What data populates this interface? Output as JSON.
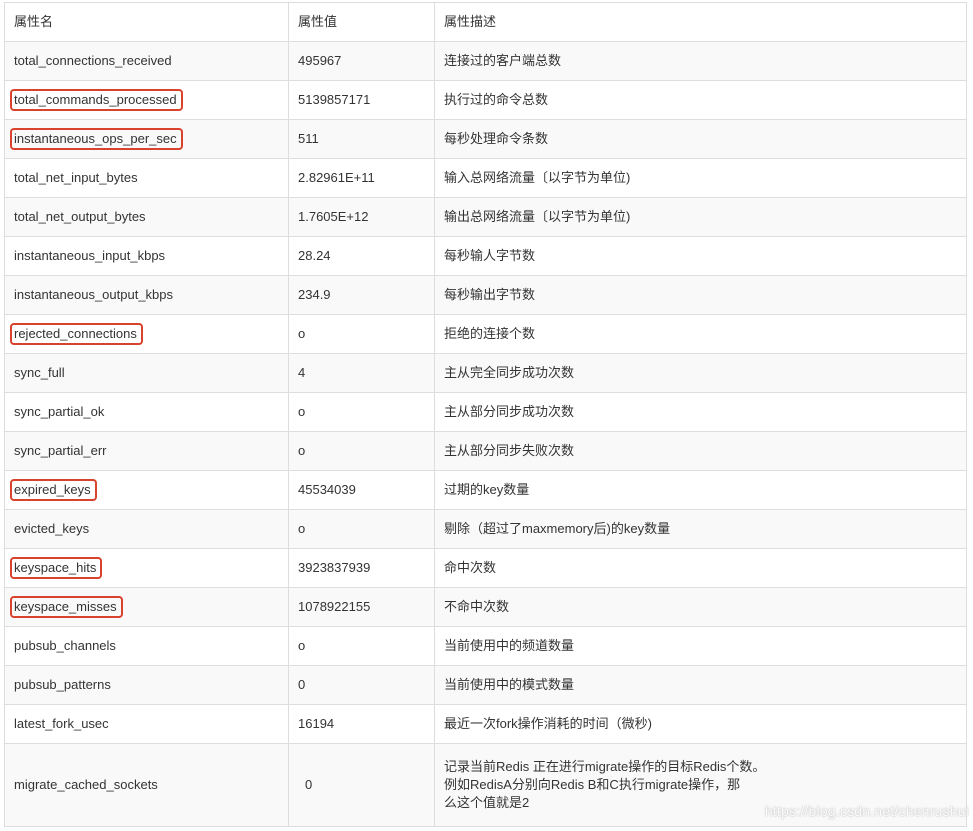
{
  "header": {
    "name": "属性名",
    "value": "属性值",
    "desc": "属性描述"
  },
  "rows": [
    {
      "name": "total_connections_received",
      "value": "495967",
      "desc": "连接过的客户端总数",
      "highlighted": false
    },
    {
      "name": "total_commands_processed",
      "value": "5139857171",
      "desc": "执行过的命令总数",
      "highlighted": true
    },
    {
      "name": "instantaneous_ops_per_sec",
      "value": "511",
      "desc": "每秒处理命令条数",
      "highlighted": true
    },
    {
      "name": "total_net_input_bytes",
      "value": "2.82961E+11",
      "desc": "输入总网络流量〔以字节为单位)",
      "highlighted": false
    },
    {
      "name": "total_net_output_bytes",
      "value": "1.7605E+12",
      "desc": "输出总网络流量〔以字节为单位)",
      "highlighted": false
    },
    {
      "name": "instantaneous_input_kbps",
      "value": "28.24",
      "desc": "每秒输人字节数",
      "highlighted": false
    },
    {
      "name": "instantaneous_output_kbps",
      "value": "234.9",
      "desc": "每秒输出字节数",
      "highlighted": false
    },
    {
      "name": "rejected_connections",
      "value": "o",
      "desc": "拒绝的连接个数",
      "highlighted": true
    },
    {
      "name": "sync_full",
      "value": "4",
      "desc": "主从完全同步成功次数",
      "highlighted": false
    },
    {
      "name": "sync_partial_ok",
      "value": "o",
      "desc": "主从部分同步成功次数",
      "highlighted": false
    },
    {
      "name": "sync_partial_err",
      "value": "o",
      "desc": "主从部分同步失败次数",
      "highlighted": false
    },
    {
      "name": "expired_keys",
      "value": "45534039",
      "desc": "过期的key数量",
      "highlighted": true
    },
    {
      "name": "evicted_keys",
      "value": "o",
      "desc": "剔除（超过了maxmemory后)的key数量",
      "highlighted": false
    },
    {
      "name": "keyspace_hits",
      "value": "3923837939",
      "desc": "命中次数",
      "highlighted": true
    },
    {
      "name": "keyspace_misses",
      "value": "1078922155",
      "desc": "不命中次数",
      "highlighted": true
    },
    {
      "name": "pubsub_channels",
      "value": "o",
      "desc": "当前使用中的频道数量",
      "highlighted": false
    },
    {
      "name": "pubsub_patterns",
      "value": "0",
      "desc": "当前使用中的模式数量",
      "highlighted": false
    },
    {
      "name": "latest_fork_usec",
      "value": "16194",
      "desc": "最近一次fork操作消耗的时间（微秒)",
      "highlighted": false
    }
  ],
  "last_row": {
    "name": "migrate_cached_sockets",
    "value": "0",
    "desc_lines": [
      "记录当前Redis 正在进行migrate操作的目标Redis个数。",
      "例如RedisA分别向Redis B和C执行migrate操作，那",
      "么这个值就是2"
    ]
  },
  "watermark": "https://blog.csdn.net/chenrushui",
  "colors": {
    "highlight_border": "#d9422d",
    "grid_line": "#dddddd",
    "alt_row_bg": "#f9f9f9",
    "text": "#333333"
  }
}
